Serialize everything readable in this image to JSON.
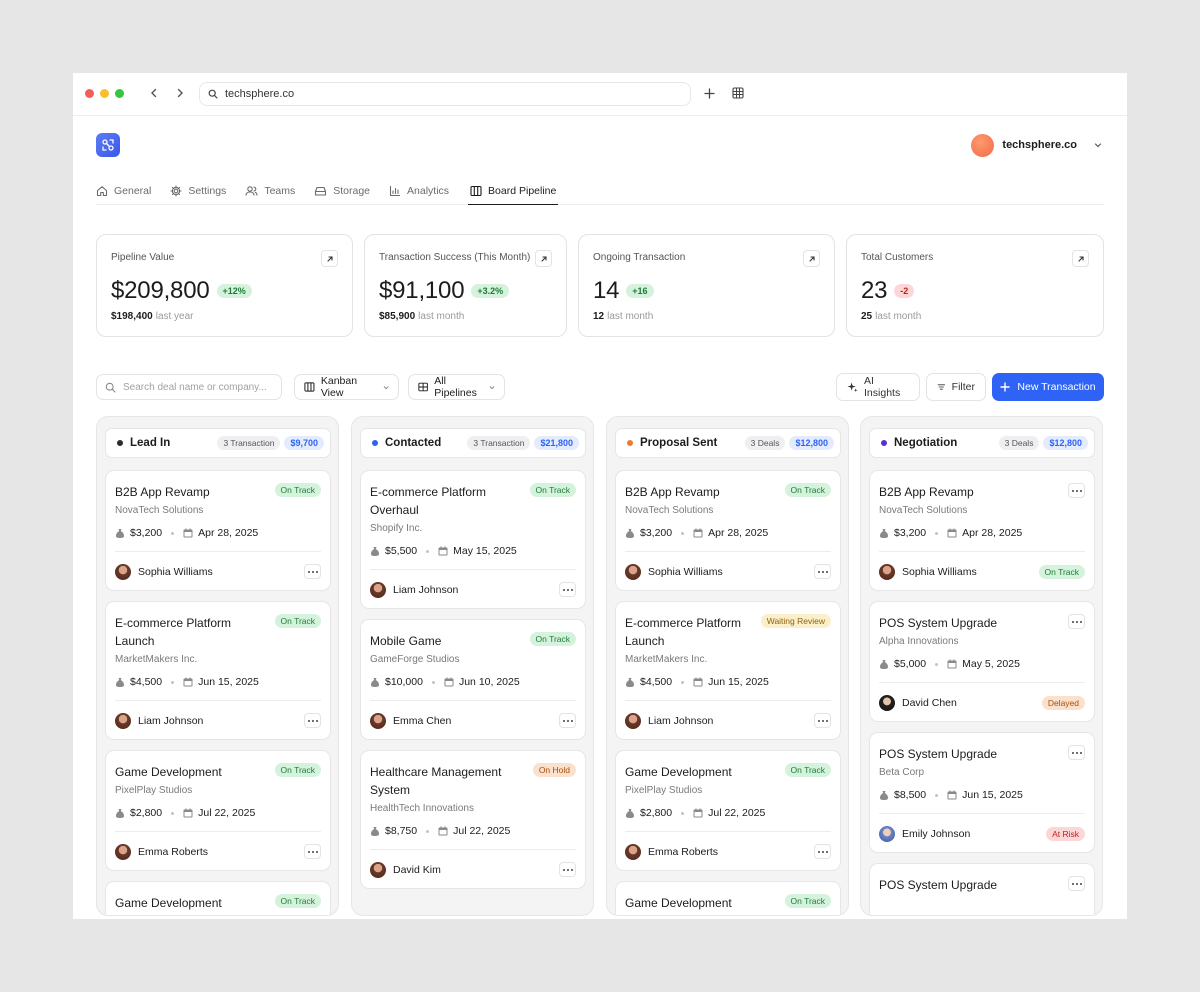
{
  "browser": {
    "url": "techsphere.co"
  },
  "account": {
    "name": "techsphere.co"
  },
  "tabs": [
    {
      "label": "General",
      "icon": "home-icon"
    },
    {
      "label": "Settings",
      "icon": "gear-icon"
    },
    {
      "label": "Teams",
      "icon": "users-icon"
    },
    {
      "label": "Storage",
      "icon": "storage-icon"
    },
    {
      "label": "Analytics",
      "icon": "bar-chart-icon"
    },
    {
      "label": "Board Pipeline",
      "icon": "columns-icon",
      "active": true
    }
  ],
  "metrics": [
    {
      "label": "Pipeline Value",
      "value": "$209,800",
      "change": "+12%",
      "change_type": "positive",
      "prev_value": "$198,400",
      "prev_label": "last year"
    },
    {
      "label": "Transaction Success (This Month)",
      "value": "$91,100",
      "change": "+3.2%",
      "change_type": "positive",
      "prev_value": "$85,900",
      "prev_label": "last month"
    },
    {
      "label": "Ongoing Transaction",
      "value": "14",
      "change": "+16",
      "change_type": "positive",
      "prev_value": "12",
      "prev_label": "last month"
    },
    {
      "label": "Total Customers",
      "value": "23",
      "change": "-2",
      "change_type": "negative",
      "prev_value": "25",
      "prev_label": "last month"
    }
  ],
  "toolbar": {
    "search_placeholder": "Search deal name or company...",
    "view_label": "Kanban View",
    "pipelines_label": "All Pipelines",
    "ai_label": "AI Insights",
    "filter_label": "Filter",
    "new_label": "New Transaction"
  },
  "colors": {
    "accent": "#2e63f5",
    "lead": "#2b2b2b",
    "contacted": "#2e63f5",
    "proposal": "#f07a2c",
    "negotiation": "#5a2fd0"
  },
  "columns": [
    {
      "title": "Lead In",
      "count": "3 Transaction",
      "amount": "$9,700",
      "cards": [
        {
          "title": "B2B App Revamp",
          "company": "NovaTech Solutions",
          "amount": "$3,200",
          "date": "Apr 28, 2025",
          "person": "Sophia Williams",
          "status": "On Track"
        },
        {
          "title": "E-commerce Platform Launch",
          "company": "MarketMakers Inc.",
          "amount": "$4,500",
          "date": "Jun 15, 2025",
          "person": "Liam Johnson",
          "status": "On Track"
        },
        {
          "title": "Game Development",
          "company": "PixelPlay Studios",
          "amount": "$2,800",
          "date": "Jul 22, 2025",
          "person": "Emma Roberts",
          "status": "On Track"
        },
        {
          "title": "Game Development",
          "status": "On Track"
        }
      ]
    },
    {
      "title": "Contacted",
      "count": "3 Transaction",
      "amount": "$21,800",
      "cards": [
        {
          "title": "E-commerce Platform Overhaul",
          "company": "Shopify Inc.",
          "amount": "$5,500",
          "date": "May 15, 2025",
          "person": "Liam Johnson",
          "status": "On Track"
        },
        {
          "title": "Mobile Game",
          "company": "GameForge Studios",
          "amount": "$10,000",
          "date": "Jun 10, 2025",
          "person": "Emma Chen",
          "status": "On Track"
        },
        {
          "title": "Healthcare Management System",
          "company": "HealthTech Innovations",
          "amount": "$8,750",
          "date": "Jul 22, 2025",
          "person": "David Kim",
          "status": "On Hold"
        }
      ]
    },
    {
      "title": "Proposal Sent",
      "count": "3 Deals",
      "amount": "$12,800",
      "cards": [
        {
          "title": "B2B App Revamp",
          "company": "NovaTech Solutions",
          "amount": "$3,200",
          "date": "Apr 28, 2025",
          "person": "Sophia Williams",
          "status": "On Track"
        },
        {
          "title": "E-commerce Platform Launch",
          "company": "MarketMakers Inc.",
          "amount": "$4,500",
          "date": "Jun 15, 2025",
          "person": "Liam Johnson",
          "status": "Waiting Review"
        },
        {
          "title": "Game Development",
          "company": "PixelPlay Studios",
          "amount": "$2,800",
          "date": "Jul 22, 2025",
          "person": "Emma Roberts",
          "status": "On Track"
        },
        {
          "title": "Game Development",
          "status": "On Track"
        }
      ]
    },
    {
      "title": "Negotiation",
      "count": "3 Deals",
      "amount": "$12,800",
      "cards": [
        {
          "title": "B2B App Revamp",
          "company": "NovaTech Solutions",
          "amount": "$3,200",
          "date": "Apr 28, 2025",
          "person": "Sophia Williams",
          "status": "On Track"
        },
        {
          "title": "POS System Upgrade",
          "company": "Alpha Innovations",
          "amount": "$5,000",
          "date": "May 5, 2025",
          "person": "David Chen",
          "status": "Delayed"
        },
        {
          "title": "POS System Upgrade",
          "company": "Beta Corp",
          "amount": "$8,500",
          "date": "Jun 15, 2025",
          "person": "Emily Johnson",
          "status": "At Risk"
        },
        {
          "title": "POS System Upgrade"
        }
      ]
    }
  ]
}
